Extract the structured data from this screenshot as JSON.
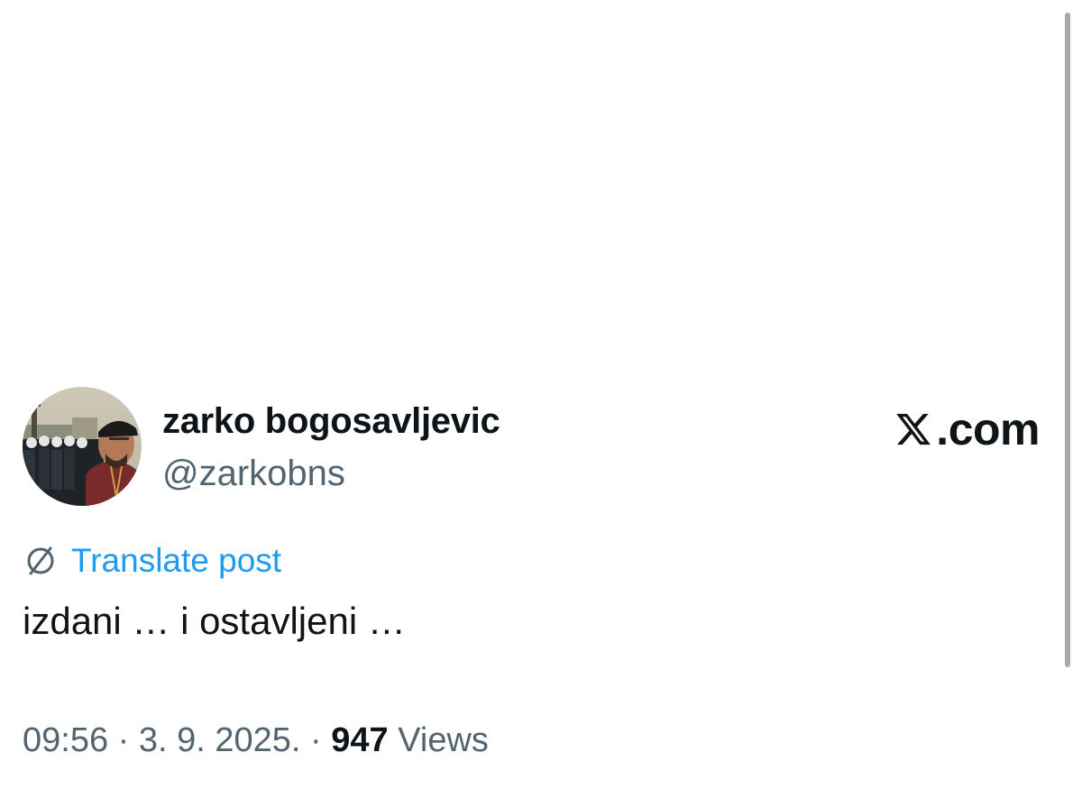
{
  "author": {
    "display_name": "zarko bogosavljevic",
    "handle": "@zarkobns",
    "avatar_icon": "profile-photo"
  },
  "brand": {
    "text": ".com",
    "icon": "x-logo-icon"
  },
  "translate": {
    "label": "Translate post",
    "icon": "globe-icon",
    "color": "#1d9bf0"
  },
  "post": {
    "text": "izdani … i ostavljeni …"
  },
  "meta": {
    "time": "09:56",
    "separator": "·",
    "date": "3. 9. 2025.",
    "views_count": "947",
    "views_label": "Views"
  },
  "colors": {
    "text_primary": "#0f1419",
    "text_secondary": "#536471",
    "link": "#1d9bf0",
    "scrollbar": "#a9a9ab"
  }
}
